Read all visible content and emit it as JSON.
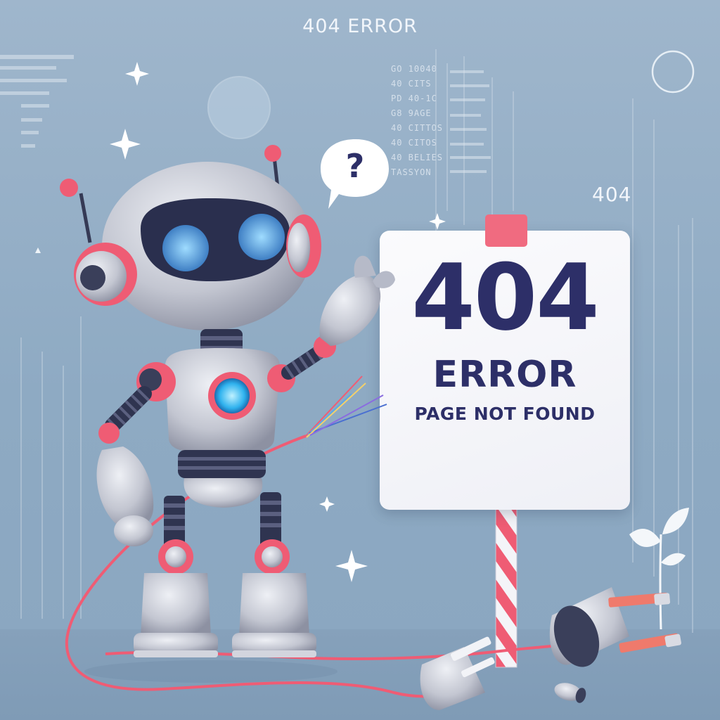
{
  "header": {
    "title": "404 ERROR"
  },
  "side_label": "404",
  "background_code_lines": [
    "GO 10040",
    "40 CITS",
    "PD 40-1C",
    "G8 9AGE",
    "40 CITTOS",
    "40 CITOS",
    "40 BELIES",
    "TASSYON"
  ],
  "speech_bubble": {
    "text": "?"
  },
  "sign": {
    "code": "404",
    "title": "ERROR",
    "subtitle": "PAGE NOT FOUND"
  },
  "colors": {
    "background": "#9fb6cc",
    "accent_pink": "#f06b80",
    "sign_text": "#2d2f68",
    "robot_body": "#c9ccd6",
    "eye_glow": "#5bb8f0"
  },
  "icons": [
    "question-icon",
    "sparkle-icon",
    "plug-icon",
    "leaf-icon",
    "circle-icon"
  ]
}
